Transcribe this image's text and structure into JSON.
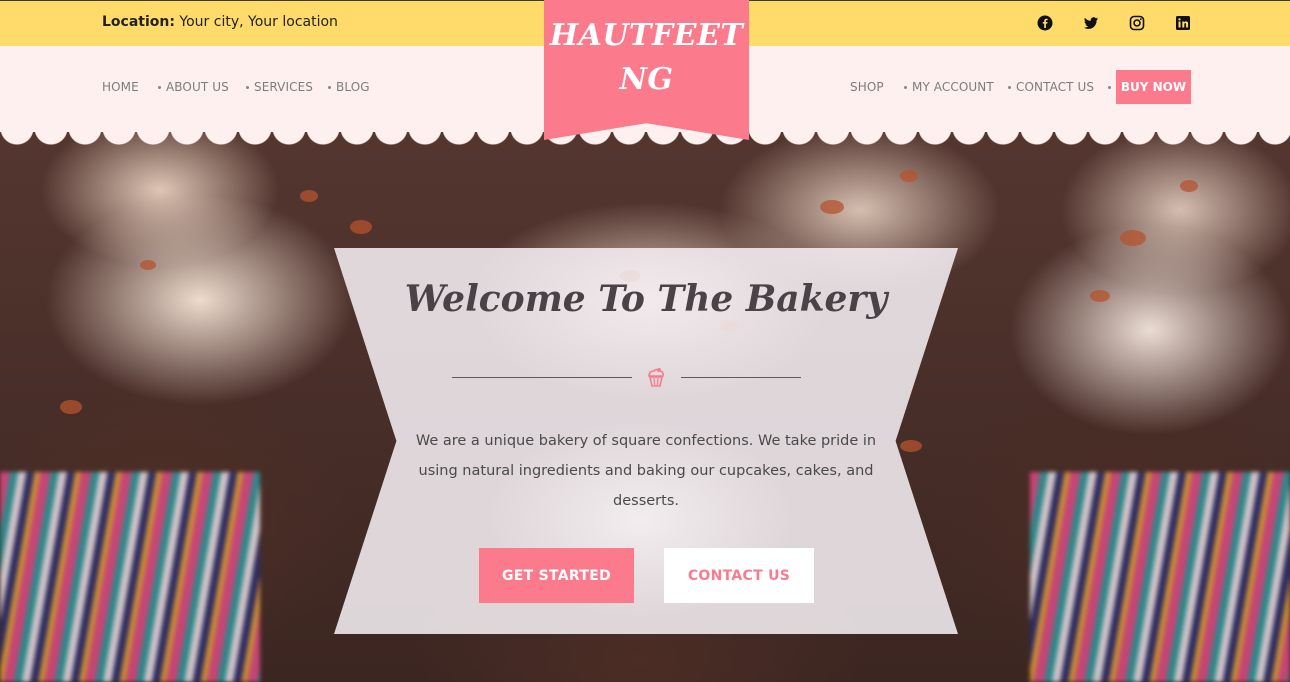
{
  "brand": {
    "logo_line1": "HAUTFEET",
    "logo_line2": "NG",
    "accent_color": "#fb7b8c",
    "topbar_color": "#fedb6a",
    "nav_bg_color": "#fdf0ef"
  },
  "topbar": {
    "location_label": "Location:",
    "location_value": "Your city, Your location",
    "social_icons": [
      "facebook-icon",
      "twitter-icon",
      "instagram-icon",
      "linkedin-icon"
    ]
  },
  "nav": {
    "left_items": [
      "HOME",
      "ABOUT US",
      "SERVICES",
      "BLOG"
    ],
    "right_items": [
      "SHOP",
      "MY ACCOUNT",
      "CONTACT US"
    ],
    "buy_now_label": "BUY NOW"
  },
  "hero": {
    "title": "Welcome To The Bakery",
    "divider_icon": "cupcake-icon",
    "description": "We are a unique bakery of square confections. We take pride in using natural ingredients and baking our cupcakes, cakes, and desserts.",
    "primary_button": "GET STARTED",
    "secondary_button": "CONTACT US"
  }
}
